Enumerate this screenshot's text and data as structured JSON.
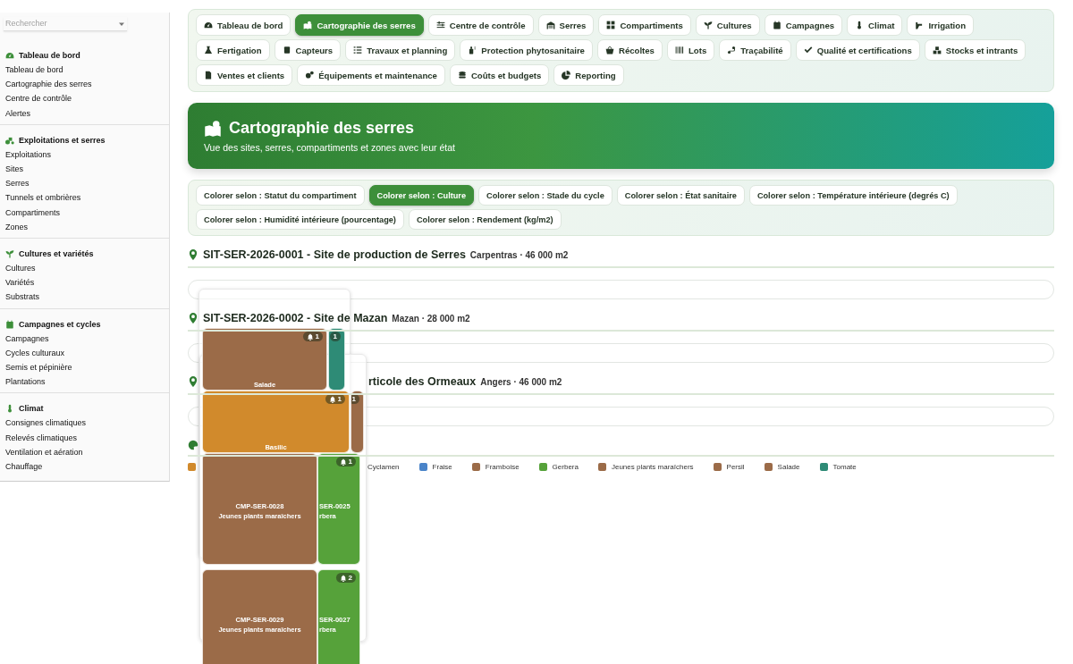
{
  "sidebar": {
    "search": {
      "placeholder": "Rechercher"
    },
    "groups": [
      {
        "title": "Tableau de bord",
        "items": [
          "Tableau de bord",
          "Cartographie des serres",
          "Centre de contrôle",
          "Alertes"
        ]
      },
      {
        "title": "Exploitations et serres",
        "items": [
          "Exploitations",
          "Sites",
          "Serres",
          "Tunnels et ombrières",
          "Compartiments",
          "Zones"
        ]
      },
      {
        "title": "Cultures et variétés",
        "items": [
          "Cultures",
          "Variétés",
          "Substrats"
        ]
      },
      {
        "title": "Campagnes et cycles",
        "items": [
          "Campagnes",
          "Cycles culturaux",
          "Semis et pépinière",
          "Plantations"
        ]
      },
      {
        "title": "Climat",
        "items": [
          "Consignes climatiques",
          "Relevés climatiques",
          "Ventilation et aération",
          "Chauffage"
        ]
      }
    ]
  },
  "nav": [
    {
      "label": "Tableau de bord",
      "selected": false
    },
    {
      "label": "Cartographie des serres",
      "selected": true
    },
    {
      "label": "Centre de contrôle",
      "selected": false
    },
    {
      "label": "Serres",
      "selected": false
    },
    {
      "label": "Compartiments",
      "selected": false
    },
    {
      "label": "Cultures",
      "selected": false
    },
    {
      "label": "Campagnes",
      "selected": false
    },
    {
      "label": "Climat",
      "selected": false
    },
    {
      "label": "Irrigation",
      "selected": false
    },
    {
      "label": "Fertigation",
      "selected": false
    },
    {
      "label": "Capteurs",
      "selected": false
    },
    {
      "label": "Travaux et planning",
      "selected": false
    },
    {
      "label": "Protection phytosanitaire",
      "selected": false
    },
    {
      "label": "Récoltes",
      "selected": false
    },
    {
      "label": "Lots",
      "selected": false
    },
    {
      "label": "Traçabilité",
      "selected": false
    },
    {
      "label": "Qualité et certifications",
      "selected": false
    },
    {
      "label": "Stocks et intrants",
      "selected": false
    },
    {
      "label": "Ventes et clients",
      "selected": false
    },
    {
      "label": "Équipements et maintenance",
      "selected": false
    },
    {
      "label": "Coûts et budgets",
      "selected": false
    },
    {
      "label": "Reporting",
      "selected": false
    }
  ],
  "banner": {
    "title": "Cartographie des serres",
    "subtitle": "Vue des sites, serres, compartiments et zones avec leur état"
  },
  "color_modes": [
    {
      "label": "Colorer selon : Statut du compartiment",
      "selected": false
    },
    {
      "label": "Colorer selon : Culture",
      "selected": true
    },
    {
      "label": "Colorer selon : Stade du cycle",
      "selected": false
    },
    {
      "label": "Colorer selon : État sanitaire",
      "selected": false
    },
    {
      "label": "Colorer selon : Température intérieure (degrés C)",
      "selected": false
    },
    {
      "label": "Colorer selon : Humidité intérieure (pourcentage)",
      "selected": false
    },
    {
      "label": "Colorer selon : Rendement (kg/m2)",
      "selected": false
    }
  ],
  "sites": [
    {
      "title": "SIT-SER-2026-0001 - Site de production de Serres",
      "meta": "Carpentras · 46 000 m2"
    },
    {
      "title": "SIT-SER-2026-0002 - Site de Mazan",
      "meta": "Mazan · 28 000 m2"
    },
    {
      "title": "rticole des Ormeaux",
      "meta": "Angers · 46 000 m2"
    }
  ],
  "legend": [
    {
      "color": "#d18a2c"
    },
    {
      "label": "Cyclamen"
    },
    {
      "label": "Fraise",
      "color": "#4a84c9"
    },
    {
      "label": "Framboise",
      "color": "#9b6b48"
    },
    {
      "label": "Gerbera",
      "color": "#56a23a"
    },
    {
      "label": "Jeunes plants maraîchers",
      "color": "#9b6b48"
    },
    {
      "label": "Persil",
      "color": "#9b6b48"
    },
    {
      "label": "Salade",
      "color": "#9b6b48"
    },
    {
      "label": "Tomate",
      "color": "#2e8b76"
    }
  ],
  "tiles": [
    {
      "color": "#9b6b48",
      "alerts": "1",
      "caption": "Salade"
    },
    {
      "color": "#2e8b76",
      "alerts": "1"
    },
    {
      "color": "#d18a2c",
      "alerts": "1",
      "caption": "Basilic"
    },
    {
      "color": "#9b6b48",
      "alerts": "1"
    },
    {
      "color": "#9b6b48",
      "code": "CMP-SER-0028",
      "crop": "Jeunes plants maraîchers"
    },
    {
      "color": "#56a23a",
      "alerts": "1",
      "code": "SER-0025",
      "crop": "rbera"
    },
    {
      "color": "#9b6b48",
      "code": "CMP-SER-0029",
      "crop": "Jeunes plants maraîchers"
    },
    {
      "color": "#56a23a",
      "alerts": "2",
      "code": "SER-0027",
      "crop": "rbera"
    }
  ]
}
